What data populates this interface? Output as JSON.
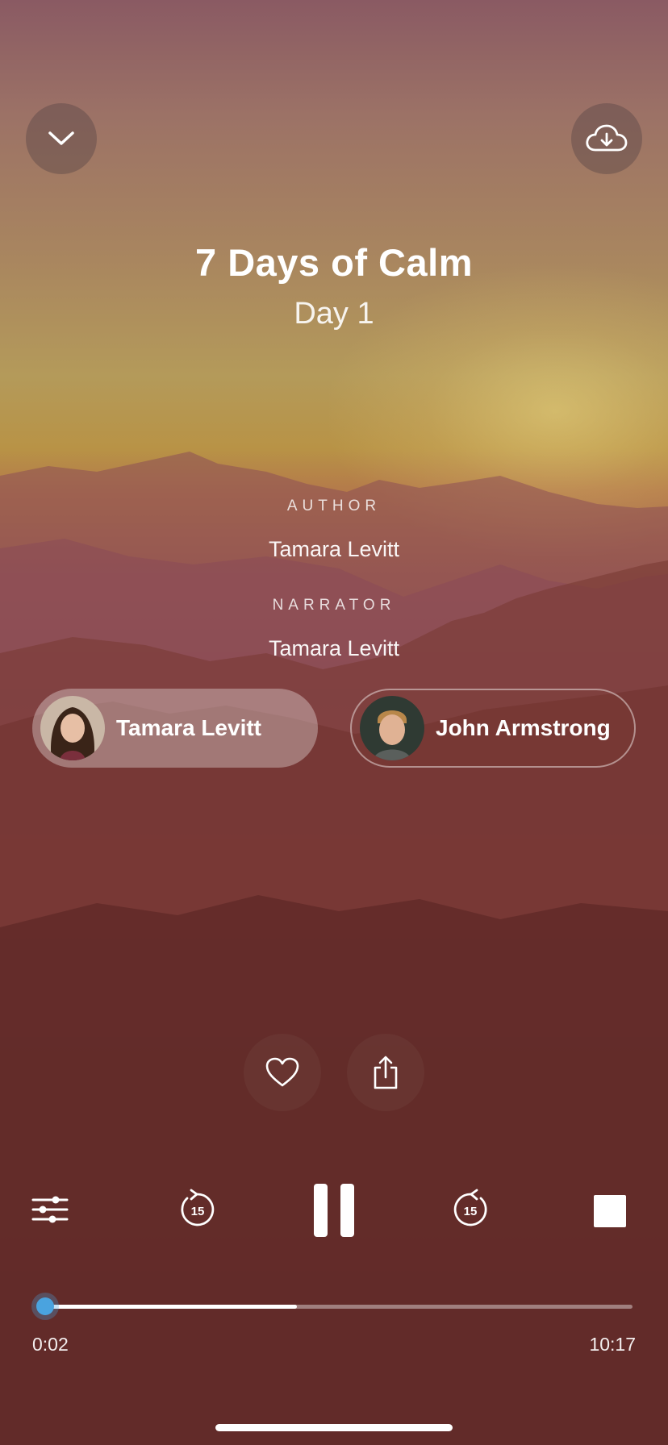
{
  "session": {
    "title": "7 Days of Calm",
    "subtitle": "Day 1"
  },
  "credits": {
    "author_label": "AUTHOR",
    "author_name": "Tamara Levitt",
    "narrator_label": "NARRATOR",
    "narrator_name": "Tamara Levitt"
  },
  "narrators": [
    {
      "name": "Tamara Levitt",
      "selected": true
    },
    {
      "name": "John Armstrong",
      "selected": false
    }
  ],
  "icons": {
    "close": "chevron-down-icon",
    "download": "cloud-download-icon",
    "favorite": "heart-icon",
    "share": "share-icon",
    "settings": "sliders-icon",
    "rewind": "rewind-15-icon",
    "pause": "pause-icon",
    "forward": "forward-15-icon",
    "stop": "stop-icon"
  },
  "player": {
    "skip_seconds": "15",
    "elapsed": "0:02",
    "duration": "10:17",
    "played_fraction": 0.003,
    "buffered_fraction": 0.43
  },
  "colors": {
    "progress_knob": "#4aa3df"
  }
}
